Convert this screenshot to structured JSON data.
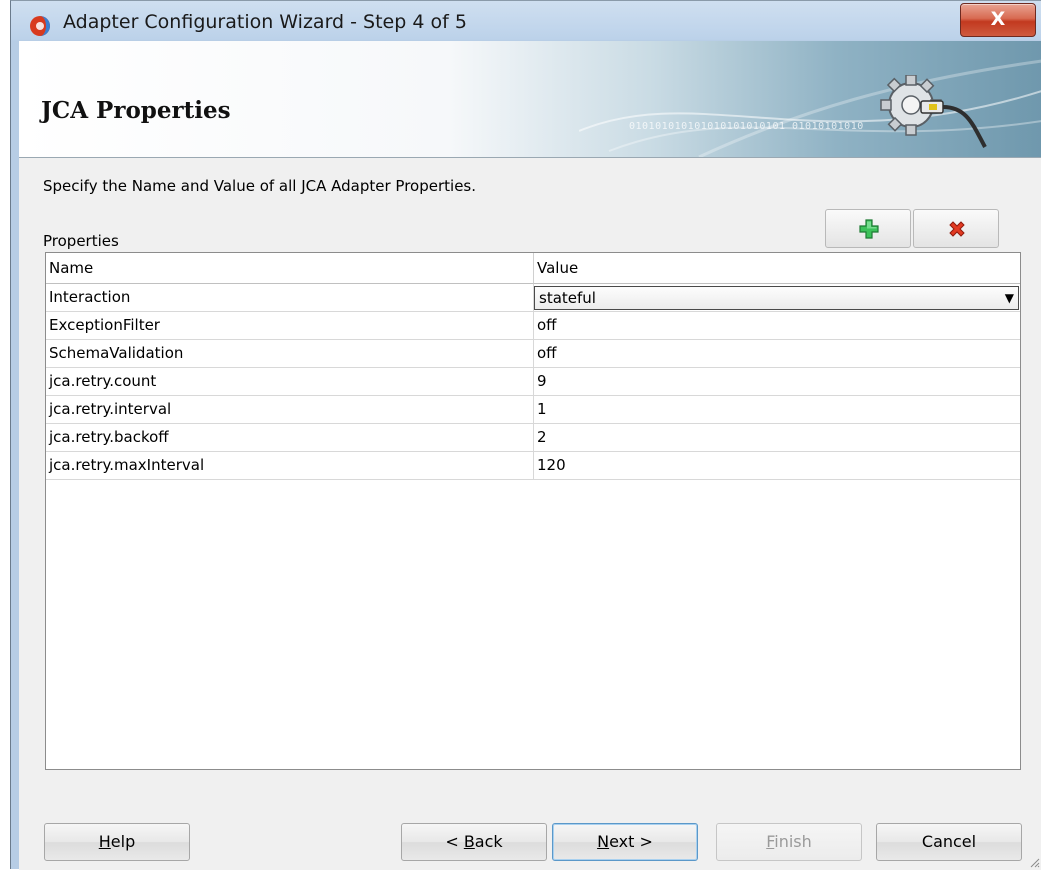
{
  "window": {
    "title": "Adapter Configuration Wizard - Step 4 of 5",
    "close_label": "X"
  },
  "banner": {
    "title": "JCA Properties",
    "binary_text": "010101010101010101010101 01010101010"
  },
  "instruction": "Specify the Name and Value of all JCA Adapter Properties.",
  "properties_label": "Properties",
  "table": {
    "columns": [
      "Name",
      "Value"
    ],
    "rows": [
      {
        "name": "Interaction",
        "value": "stateful"
      },
      {
        "name": "ExceptionFilter",
        "value": "off"
      },
      {
        "name": "SchemaValidation",
        "value": "off"
      },
      {
        "name": "jca.retry.count",
        "value": "9"
      },
      {
        "name": "jca.retry.interval",
        "value": "1"
      },
      {
        "name": "jca.retry.backoff",
        "value": "2"
      },
      {
        "name": "jca.retry.maxInterval",
        "value": "120"
      }
    ]
  },
  "toolbar": {
    "add_icon": "plus-icon",
    "delete_icon": "x-icon"
  },
  "buttons": {
    "help": {
      "mnemonic": "H",
      "rest": "elp"
    },
    "back": {
      "pre": "< ",
      "mnemonic": "B",
      "rest": "ack"
    },
    "next": {
      "mnemonic": "N",
      "rest": "ext >"
    },
    "finish": {
      "mnemonic": "F",
      "rest": "inish"
    },
    "cancel": "Cancel"
  },
  "colors": {
    "add_green": "#28b04a",
    "delete_red": "#d9301c",
    "close_red": "#c2391f"
  }
}
